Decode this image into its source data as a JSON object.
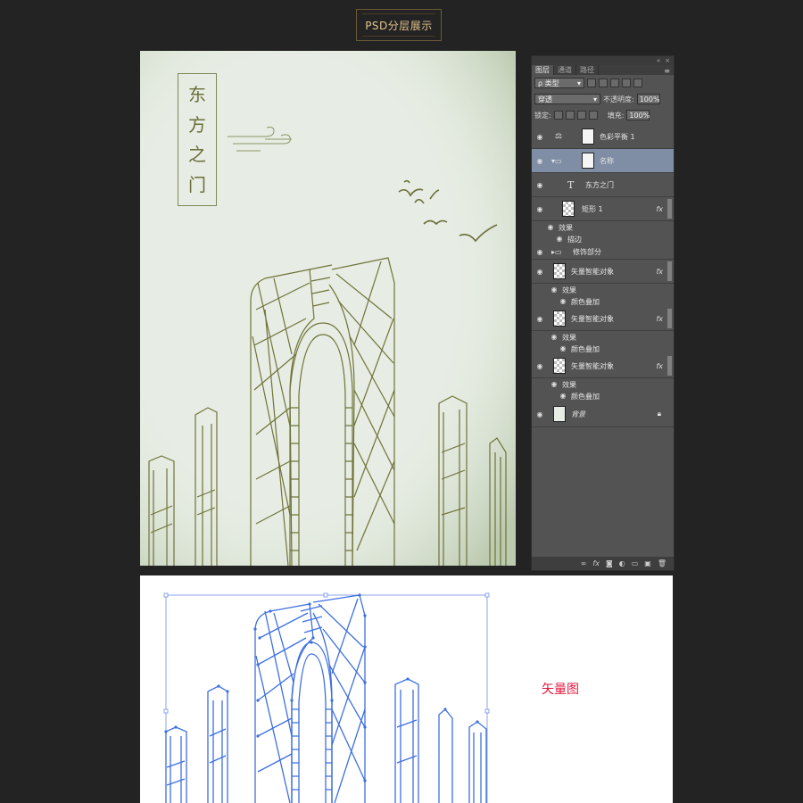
{
  "header": {
    "badge": "PSD分层展示"
  },
  "poster": {
    "title_chars": [
      "东",
      "方",
      "之",
      "门"
    ]
  },
  "panel": {
    "tabs": [
      "图层",
      "通道",
      "路径"
    ],
    "filter": {
      "label": "ρ 类型"
    },
    "blend_mode": "穿透",
    "opacity_label": "不透明度:",
    "opacity_value": "100%",
    "lock_label": "锁定:",
    "fill_label": "填充:",
    "fill_value": "100%",
    "layers": [
      {
        "name": "色彩平衡 1"
      },
      {
        "name": "名称"
      },
      {
        "name": "东方之门"
      },
      {
        "name": "矩形 1",
        "effects_label": "效果",
        "effect": "描边"
      },
      {
        "name": "修饰部分"
      },
      {
        "name": "矢量智能对象",
        "effects_label": "效果",
        "effect": "颜色叠加"
      },
      {
        "name": "矢量智能对象",
        "effects_label": "效果",
        "effect": "颜色叠加"
      },
      {
        "name": "矢量智能对象",
        "effects_label": "效果",
        "effect": "颜色叠加"
      },
      {
        "name": "背景"
      }
    ]
  },
  "vector": {
    "label": "矢量图"
  },
  "colors": {
    "accent_gold": "#e2c58d",
    "poster_line": "#6a6e39",
    "vector_blue": "#3d6fe0",
    "label_red": "#e2173e"
  }
}
